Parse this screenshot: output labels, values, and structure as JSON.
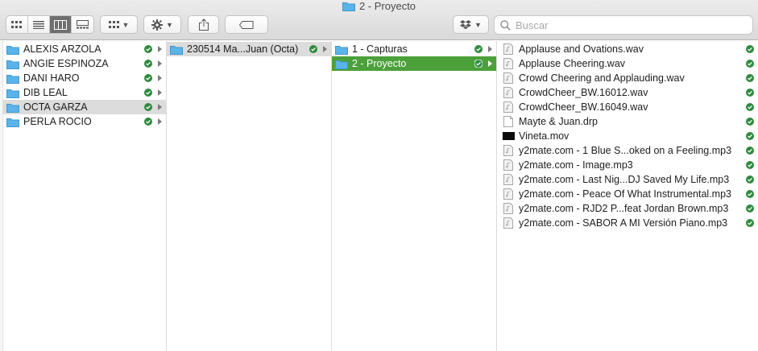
{
  "window": {
    "title": "2 - Proyecto"
  },
  "toolbar": {
    "view_buttons": [
      "icon-view",
      "list-view",
      "column-view",
      "gallery-view"
    ],
    "active_view": "column-view",
    "search_placeholder": "Buscar"
  },
  "colors": {
    "accent": "#4ba03a",
    "status_ok": "#2e8b3e",
    "folder": "#5ab4ea"
  },
  "columns": [
    {
      "items": [
        {
          "label": "ALEXIS ARZOLA"
        },
        {
          "label": "ANGIE ESPINOZA"
        },
        {
          "label": "DANI HARO"
        },
        {
          "label": "DIB LEAL"
        },
        {
          "label": "OCTA GARZA"
        },
        {
          "label": "PERLA ROCIO"
        }
      ]
    },
    {
      "items": [
        {
          "label": "230514 Ma...Juan (Octa)"
        }
      ]
    },
    {
      "items": [
        {
          "label": "1 - Capturas"
        },
        {
          "label": "2 - Proyecto"
        }
      ]
    },
    {
      "items": [
        {
          "label": "Applause and Ovations.wav",
          "icon": "audio-file-icon"
        },
        {
          "label": "Applause Cheering.wav",
          "icon": "audio-file-icon"
        },
        {
          "label": "Crowd Cheering and Applauding.wav",
          "icon": "audio-file-icon"
        },
        {
          "label": "CrowdCheer_BW.16012.wav",
          "icon": "audio-file-icon"
        },
        {
          "label": "CrowdCheer_BW.16049.wav",
          "icon": "audio-file-icon"
        },
        {
          "label": "Mayte & Juan.drp",
          "icon": "document-icon"
        },
        {
          "label": "Vineta.mov",
          "icon": "video-file-icon"
        },
        {
          "label": "y2mate.com - 1 Blue S...oked on a Feeling.mp3",
          "icon": "audio-file-icon"
        },
        {
          "label": "y2mate.com - Image.mp3",
          "icon": "audio-file-icon"
        },
        {
          "label": "y2mate.com - Last Nig...DJ Saved My Life.mp3",
          "icon": "audio-file-icon"
        },
        {
          "label": "y2mate.com - Peace Of What Instrumental.mp3",
          "icon": "audio-file-icon"
        },
        {
          "label": "y2mate.com - RJD2  P...feat Jordan Brown.mp3",
          "icon": "audio-file-icon"
        },
        {
          "label": "y2mate.com - SABOR A MI Versión Piano.mp3",
          "icon": "audio-file-icon"
        }
      ]
    }
  ]
}
